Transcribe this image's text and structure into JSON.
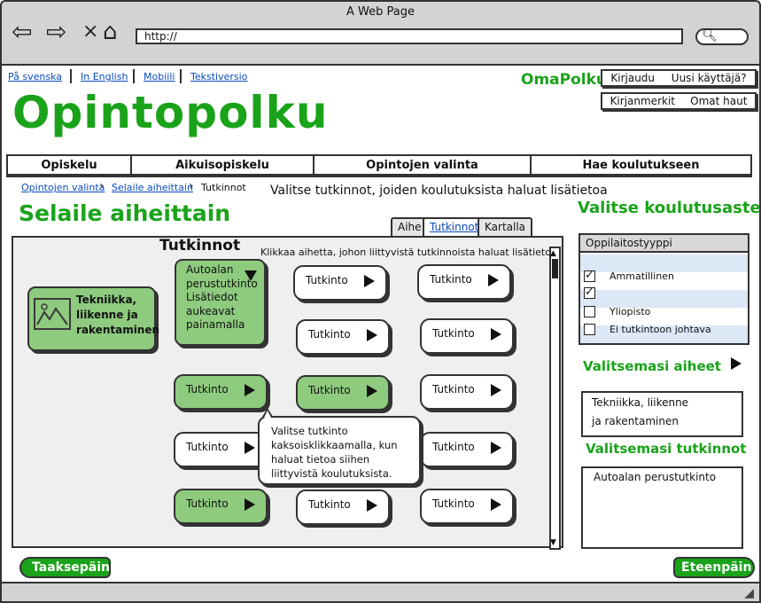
{
  "window": {
    "title": "A Web Page",
    "url": "http://"
  },
  "lang_links": [
    "På svenska",
    "In English",
    "Mobiili",
    "Tekstiversio"
  ],
  "omapolku": "OmaPolku",
  "account": {
    "login": "Kirjaudu",
    "new_user": "Uusi käyttäjä?",
    "bookmarks": "Kirjanmerkit",
    "saved_searches": "Omat haut"
  },
  "logo": "Opintopolku",
  "nav": [
    "Opiskelu",
    "Aikuisopiskelu",
    "Opintojen valinta",
    "Hae koulutukseen"
  ],
  "breadcrumb": [
    "Opintojen valinta",
    "Selaile aiheittain",
    "Tutkinnot"
  ],
  "instruction": "Valitse tutkinnot, joiden koulutuksista haluat lisätietoa",
  "page_title": "Selaile aiheittain",
  "tabs": [
    "Aihe",
    "Tutkinnot",
    "Kartalla"
  ],
  "panel": {
    "title": "Tutkinnot",
    "hint": "Klikkaa aihetta, johon liittyvistä tutkinnoista haluat lisätietoa.",
    "subject": "Tekniikka, liikenne ja rakentaminen",
    "expanded_card": [
      "Autoalan",
      "perustutkinto",
      "Lisätiedot",
      "aukeavat",
      "painamalla"
    ],
    "degree_label": "Tutkinto",
    "tooltip": [
      "Valitse tutkinto",
      "kaksoisklikkaamalla, kun",
      "haluat tietoa siihen",
      "liittyvistä koulutuksista."
    ]
  },
  "sidebar": {
    "level_title": "Valitse koulutusaste",
    "type_header": "Oppilaitostyyppi",
    "options": [
      {
        "label": "Ammatillinen",
        "checked": true
      },
      {
        "label": "",
        "checked": true
      },
      {
        "label": "Yliopisto",
        "checked": false
      },
      {
        "label": "Ei tutkintoon johtava",
        "checked": false
      }
    ],
    "subjects_title": "Valitsemasi aiheet",
    "subjects": [
      "Tekniikka, liikenne",
      "ja rakentaminen"
    ],
    "degrees_title": "Valitsemasi tutkinnot",
    "degrees": [
      "Autoalan perustutkinto"
    ]
  },
  "footer": {
    "back": "Taaksepäin",
    "next": "Eteenpäin"
  },
  "colors": {
    "accent": "#1aa31a",
    "card_green": "#8ecb7e",
    "link": "#0a4bbd"
  }
}
